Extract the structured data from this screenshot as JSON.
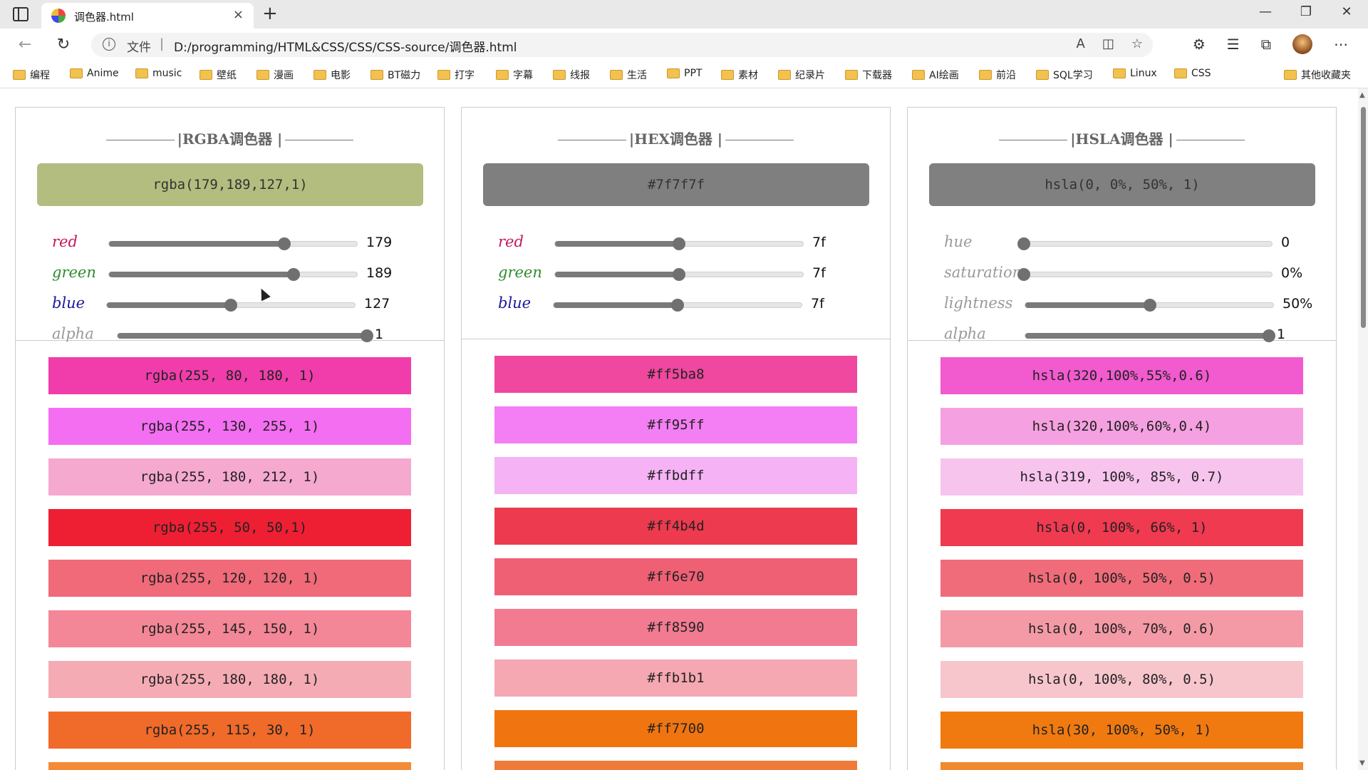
{
  "browser": {
    "tab_title": "调色器.html",
    "close_icon": "×",
    "new_tab": "+",
    "window_minimize": "—",
    "window_restore": "❐",
    "window_close": "✕",
    "address_prefix": "文件",
    "address_separator": "|",
    "url": "D:/programming/HTML&CSS/CSS/CSS-source/调色器.html",
    "bookmarks": [
      "编程",
      "Anime",
      "music",
      "壁纸",
      "漫画",
      "电影",
      "BT磁力",
      "打字",
      "字幕",
      "线报",
      "生活",
      "PPT",
      "素材",
      "纪录片",
      "下载器",
      "AI绘画",
      "前沿",
      "SQL学习",
      "Linux",
      "CSS"
    ],
    "other_bookmarks": "其他收藏夹"
  },
  "rgba": {
    "title": "|RGBA调色器 |",
    "preview_text": "rgba(179,189,127,1)",
    "preview_color": "#b3bd7f",
    "sliders": [
      {
        "label": "red",
        "value": "179",
        "fraction": 0.702,
        "color": "#c2185b"
      },
      {
        "label": "green",
        "value": "189",
        "fraction": 0.741,
        "color": "#2e8b2e"
      },
      {
        "label": "blue",
        "value": "127",
        "fraction": 0.498,
        "color": "#1a1a9a"
      },
      {
        "label": "alpha",
        "value": "1",
        "fraction": 1.0,
        "color": "#999999"
      }
    ],
    "swatches": [
      {
        "text": "rgba(255, 80, 180, 1)",
        "color": "#f03dab"
      },
      {
        "text": "rgba(255, 130, 255, 1)",
        "color": "#f46ef2"
      },
      {
        "text": "rgba(255, 180, 212, 1)",
        "color": "#f5a9cf"
      },
      {
        "text": "rgba(255, 50, 50,1)",
        "color": "#ee1f33"
      },
      {
        "text": "rgba(255, 120, 120, 1)",
        "color": "#f06a79"
      },
      {
        "text": "rgba(255, 145, 150, 1)",
        "color": "#f38797"
      },
      {
        "text": "rgba(255, 180, 180, 1)",
        "color": "#f5abb4"
      },
      {
        "text": "rgba(255, 115, 30, 1)",
        "color": "#f06a2a"
      },
      {
        "text": "",
        "color": "#f58a35"
      }
    ]
  },
  "hex": {
    "title": "|HEX调色器 |",
    "preview_text": "#7f7f7f",
    "preview_color": "#7f7f7f",
    "sliders": [
      {
        "label": "red",
        "value": "7f",
        "fraction": 0.498,
        "color": "#c2185b"
      },
      {
        "label": "green",
        "value": "7f",
        "fraction": 0.498,
        "color": "#2e8b2e"
      },
      {
        "label": "blue",
        "value": "7f",
        "fraction": 0.498,
        "color": "#1a1a9a"
      }
    ],
    "swatches": [
      {
        "text": "#ff5ba8",
        "color": "#f0479f"
      },
      {
        "text": "#ff95ff",
        "color": "#f47ef4"
      },
      {
        "text": "#ffbdff",
        "color": "#f5b3f5"
      },
      {
        "text": "#ff4b4d",
        "color": "#ee3a4f"
      },
      {
        "text": "#ff6e70",
        "color": "#ef6074"
      },
      {
        "text": "#ff8590",
        "color": "#f27b91"
      },
      {
        "text": "#ffb1b1",
        "color": "#f5a8b2"
      },
      {
        "text": "#ff7700",
        "color": "#f07510"
      },
      {
        "text": "",
        "color": "#f07a3a"
      }
    ]
  },
  "hsla": {
    "title": "|HSLA调色器 |",
    "preview_text": "hsla(0, 0%, 50%, 1)",
    "preview_color": "#808080",
    "sliders": [
      {
        "label": "hue",
        "value": "0",
        "fraction": 0.0,
        "color": "#999999"
      },
      {
        "label": "saturation",
        "value": "0%",
        "fraction": 0.0,
        "color": "#999999"
      },
      {
        "label": "lightness",
        "value": "50%",
        "fraction": 0.5,
        "color": "#999999"
      },
      {
        "label": "alpha",
        "value": "1",
        "fraction": 1.0,
        "color": "#999999"
      }
    ],
    "swatches": [
      {
        "text": "hsla(320,100%,55%,0.6)",
        "color": "#f25ad0"
      },
      {
        "text": "hsla(320,100%,60%,0.4)",
        "color": "#f5a0e0"
      },
      {
        "text": "hsla(319, 100%, 85%, 0.7)",
        "color": "#f7c4ee"
      },
      {
        "text": "hsla(0, 100%, 66%, 1)",
        "color": "#ef3a4f"
      },
      {
        "text": "hsla(0, 100%, 50%, 0.5)",
        "color": "#f06c7a"
      },
      {
        "text": "hsla(0, 100%, 70%, 0.6)",
        "color": "#f39aa6"
      },
      {
        "text": "hsla(0, 100%, 80%, 0.5)",
        "color": "#f7c6cd"
      },
      {
        "text": "hsla(30, 100%, 50%, 1)",
        "color": "#f07a10"
      },
      {
        "text": "",
        "color": "#f08a30"
      }
    ]
  }
}
